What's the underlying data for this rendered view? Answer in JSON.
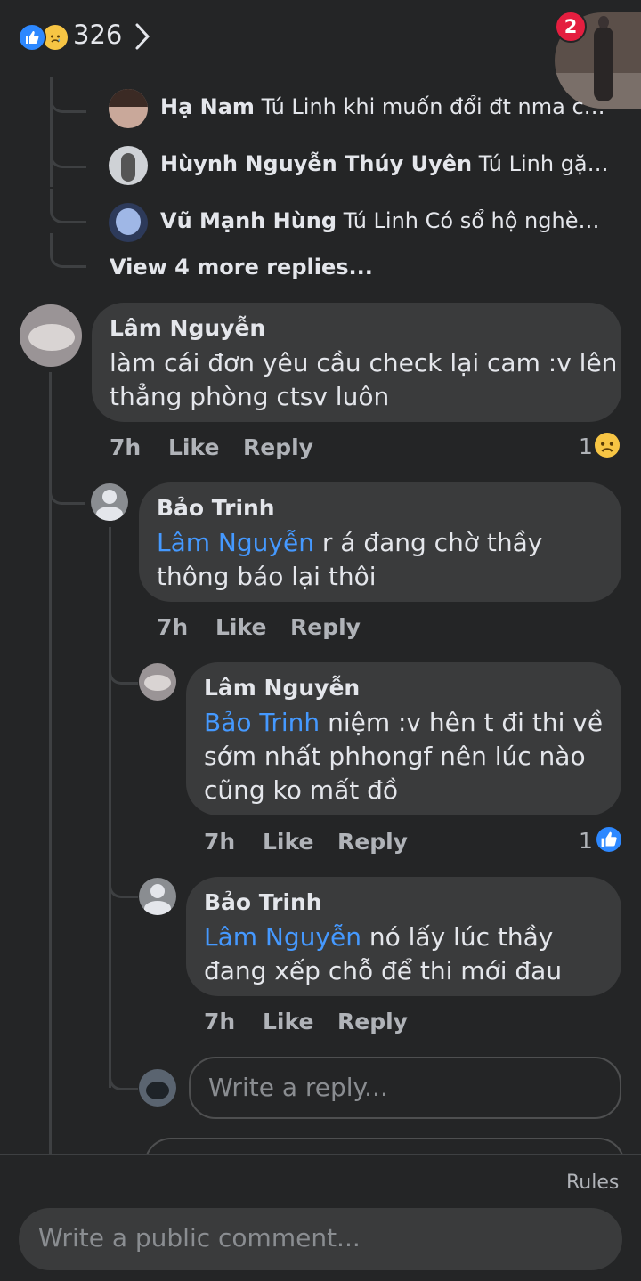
{
  "header": {
    "reaction_count": "326",
    "reaction_icons": [
      "like-icon",
      "sad-icon"
    ],
    "notification_badge": "2"
  },
  "collapsed_replies": [
    {
      "name": "Hạ Nam",
      "text": "Tú Linh khi muốn đổi đt nma cần m..."
    },
    {
      "name": "Hùynh Nguyễn Thúy Uyên",
      "text": "Tú Linh gặp nói..."
    },
    {
      "name": "Vũ Mạnh Hùng",
      "text": "Tú Linh Có sổ hộ nghèo có..."
    }
  ],
  "view_more": "View 4 more replies...",
  "comments": [
    {
      "author": "Lâm Nguyễn",
      "lines": [
        "làm cái đơn yêu cầu check lại cam :v lên",
        "thẳng phòng ctsv luôn"
      ],
      "time": "7h",
      "like": "Like",
      "reply": "Reply",
      "reaction_count": "1",
      "reaction": "sad-icon"
    },
    {
      "author": "Bảo Trinh",
      "mention": "Lâm Nguyễn",
      "lines": [
        " r á đang chờ thầy",
        "thông báo lại thôi"
      ],
      "time": "7h",
      "like": "Like",
      "reply": "Reply"
    },
    {
      "author": "Lâm Nguyễn",
      "mention": "Bảo Trinh",
      "lines": [
        " niệm :v hên t đi thi về",
        "sớm nhất phhongf nên lúc nào",
        "cũng ko mất đồ"
      ],
      "time": "7h",
      "like": "Like",
      "reply": "Reply",
      "reaction_count": "1",
      "reaction": "like-icon"
    },
    {
      "author": "Bảo Trinh",
      "mention": "Lâm Nguyễn",
      "lines": [
        " nó lấy lúc thầy",
        "đang xếp chỗ để thi mới đau"
      ],
      "time": "7h",
      "like": "Like",
      "reply": "Reply"
    }
  ],
  "reply_input": {
    "placeholder": "Write a reply..."
  },
  "footer": {
    "rules": "Rules",
    "comment_placeholder": "Write a public comment..."
  },
  "colors": {
    "background": "#242526",
    "bubble": "#3a3b3c",
    "mention": "#4599ff",
    "like_blue": "#2d88ff",
    "badge_red": "#e41e3f"
  }
}
